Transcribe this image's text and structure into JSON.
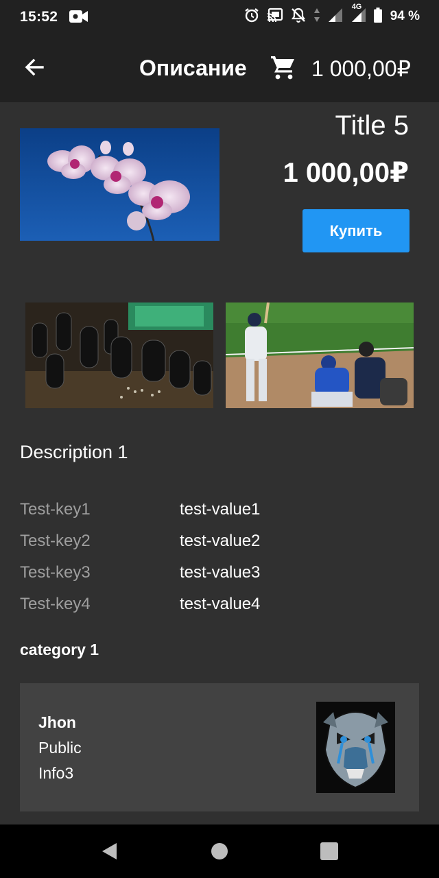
{
  "status_bar": {
    "time": "15:52",
    "battery_percent": "94 %",
    "network": "4G",
    "icons": [
      "video-camera-icon",
      "alarm-icon",
      "cast-icon",
      "notifications-off-icon",
      "signal-icon",
      "battery-icon"
    ]
  },
  "app_bar": {
    "title": "Описание",
    "cart_total": "1 000,00₽",
    "icons": [
      "back-arrow-icon",
      "shopping-cart-icon"
    ]
  },
  "product": {
    "title": "Title 5",
    "price": "1 000,00₽",
    "buy_label": "Купить",
    "description": "Description 1",
    "category": "category 1"
  },
  "specs": [
    {
      "key": "Test-key1",
      "value": "test-value1"
    },
    {
      "key": "Test-key2",
      "value": "test-value2"
    },
    {
      "key": "Test-key3",
      "value": "test-value3"
    },
    {
      "key": "Test-key4",
      "value": "test-value4"
    }
  ],
  "seller": {
    "name": "Jhon",
    "line2": "Public",
    "line3": "Info3"
  },
  "nav_bar": {
    "icons": [
      "back-triangle-icon",
      "home-circle-icon",
      "recents-square-icon"
    ]
  },
  "colors": {
    "background": "#303030",
    "app_bar": "#212121",
    "accent": "#2196f3",
    "card": "#424242",
    "muted_text": "#9e9e9e"
  }
}
